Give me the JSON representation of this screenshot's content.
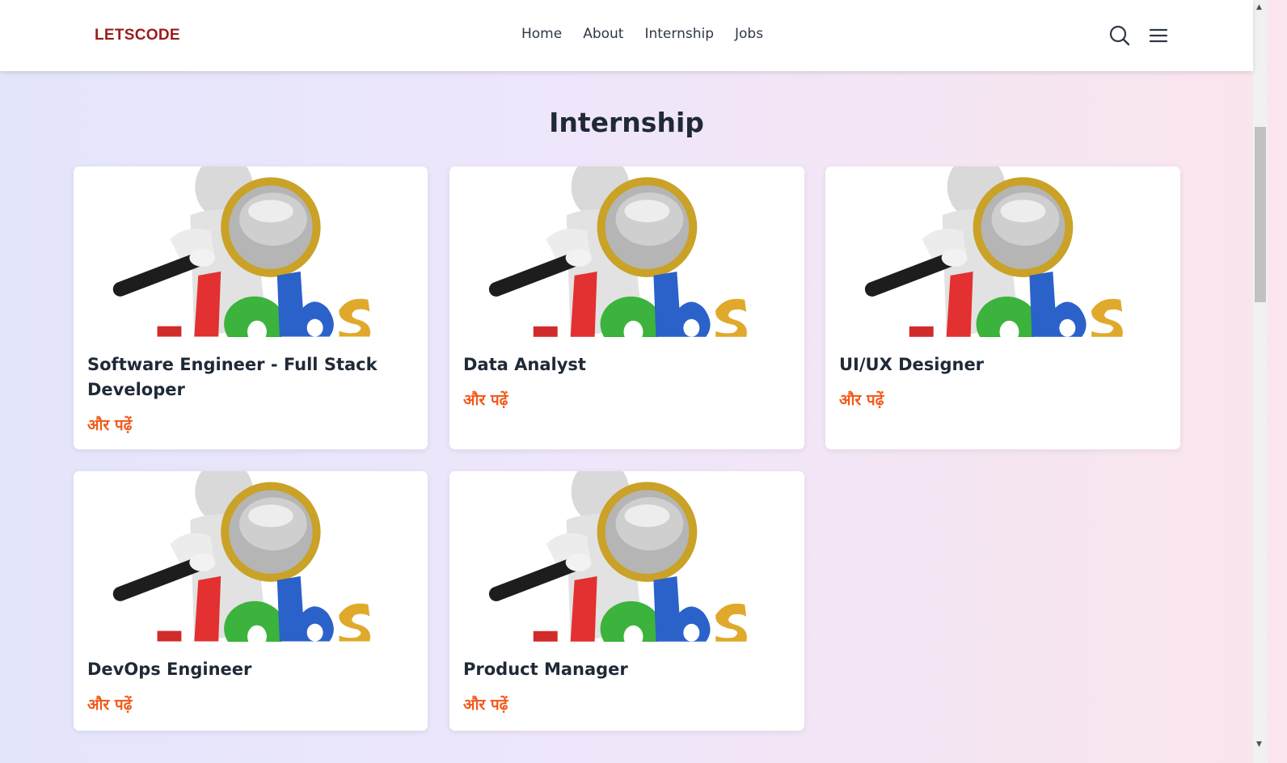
{
  "nav": {
    "logo": "LETSCODE",
    "links": [
      "Home",
      "About",
      "Internship",
      "Jobs"
    ]
  },
  "page": {
    "title": "Internship"
  },
  "cards": [
    {
      "title": "Software Engineer - Full Stack Developer",
      "link": "और पढ़ें"
    },
    {
      "title": "Data Analyst",
      "link": "और पढ़ें"
    },
    {
      "title": "UI/UX Designer",
      "link": "और पढ़ें"
    },
    {
      "title": "DevOps Engineer",
      "link": "और पढ़ें"
    },
    {
      "title": "Product Manager",
      "link": "और पढ़ें"
    }
  ],
  "colors": {
    "logo": "#9b1c1c",
    "link": "#f15a1a",
    "title": "#1f2937"
  },
  "icons": [
    "search-icon",
    "menu-icon"
  ]
}
